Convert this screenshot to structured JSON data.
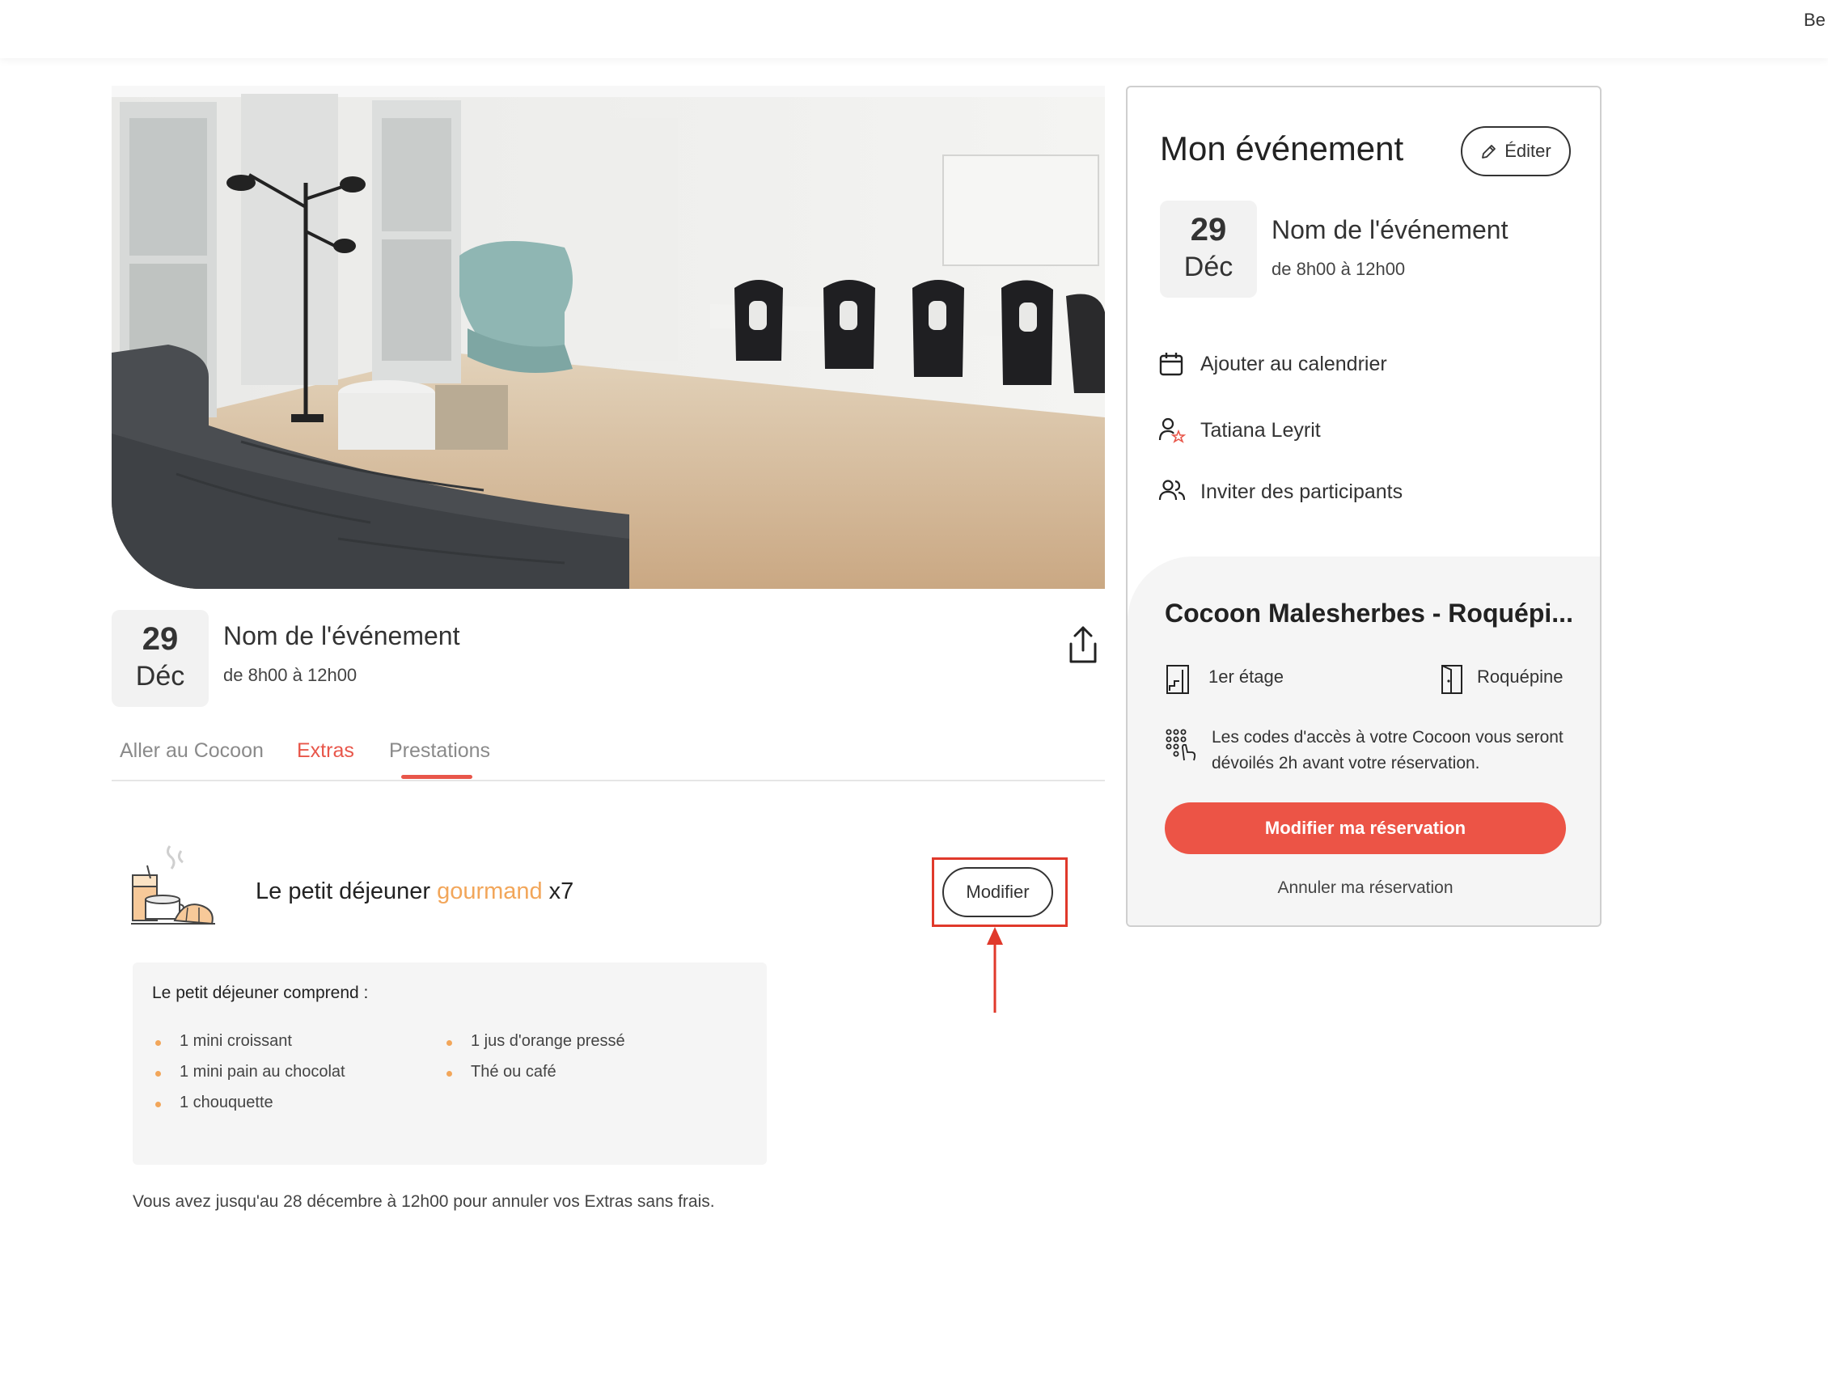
{
  "topbar": {
    "user_label": "Be"
  },
  "event": {
    "day": "29",
    "month": "Déc",
    "title": "Nom de l'événement",
    "time": "de 8h00 à 12h00"
  },
  "tabs": [
    {
      "label": "Aller au Cocoon",
      "active": false
    },
    {
      "label": "Extras",
      "active": true
    },
    {
      "label": "Prestations",
      "active": false
    }
  ],
  "extra": {
    "title_prefix": "Le petit déjeuner",
    "title_accent": "gourmand",
    "quantity": "x7",
    "modify_label": "Modifier"
  },
  "includes": {
    "title": "Le petit déjeuner comprend :",
    "left_items": [
      "1 mini croissant",
      "1 mini pain au chocolat",
      "1 chouquette"
    ],
    "right_items": [
      "1 jus d'orange pressé",
      "Thé ou café"
    ]
  },
  "cancel_note": "Vous avez jusqu'au 28 décembre à 12h00 pour annuler vos Extras sans frais.",
  "card": {
    "title": "Mon événement",
    "edit_label": "Éditer",
    "actions": [
      {
        "icon": "calendar-icon",
        "label": "Ajouter au calendrier"
      },
      {
        "icon": "organizer-icon",
        "label": "Tatiana Leyrit"
      },
      {
        "icon": "participants-icon",
        "label": "Inviter des participants"
      }
    ],
    "place": {
      "name": "Cocoon Malesherbes - Roquépi...",
      "floor": "1er étage",
      "entrance": "Roquépine",
      "codes_text": "Les codes d'accès à votre Cocoon vous seront dévoilés 2h avant votre réservation.",
      "modify_reservation_label": "Modifier ma réservation",
      "cancel_reservation_label": "Annuler ma réservation"
    }
  },
  "colors": {
    "accent_red": "#ec5446",
    "accent_orange": "#f2a65a",
    "annotation_red": "#e0392b"
  }
}
